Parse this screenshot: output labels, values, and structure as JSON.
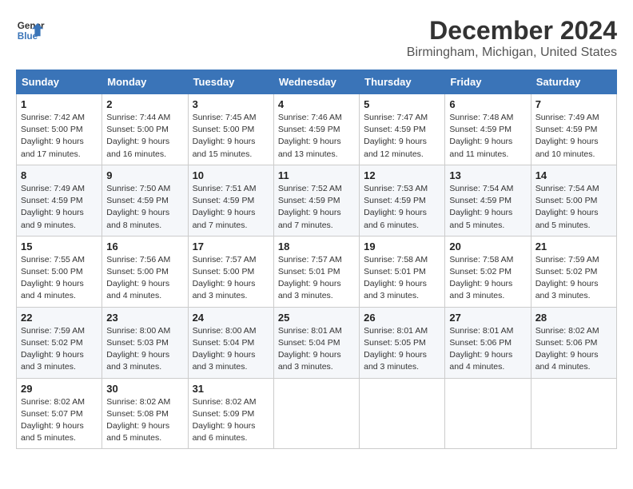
{
  "header": {
    "logo_line1": "General",
    "logo_line2": "Blue",
    "main_title": "December 2024",
    "sub_title": "Birmingham, Michigan, United States"
  },
  "columns": [
    "Sunday",
    "Monday",
    "Tuesday",
    "Wednesday",
    "Thursday",
    "Friday",
    "Saturday"
  ],
  "weeks": [
    [
      {
        "day": "1",
        "sunrise": "7:42 AM",
        "sunset": "5:00 PM",
        "daylight": "9 hours and 17 minutes."
      },
      {
        "day": "2",
        "sunrise": "7:44 AM",
        "sunset": "5:00 PM",
        "daylight": "9 hours and 16 minutes."
      },
      {
        "day": "3",
        "sunrise": "7:45 AM",
        "sunset": "5:00 PM",
        "daylight": "9 hours and 15 minutes."
      },
      {
        "day": "4",
        "sunrise": "7:46 AM",
        "sunset": "4:59 PM",
        "daylight": "9 hours and 13 minutes."
      },
      {
        "day": "5",
        "sunrise": "7:47 AM",
        "sunset": "4:59 PM",
        "daylight": "9 hours and 12 minutes."
      },
      {
        "day": "6",
        "sunrise": "7:48 AM",
        "sunset": "4:59 PM",
        "daylight": "9 hours and 11 minutes."
      },
      {
        "day": "7",
        "sunrise": "7:49 AM",
        "sunset": "4:59 PM",
        "daylight": "9 hours and 10 minutes."
      }
    ],
    [
      {
        "day": "8",
        "sunrise": "7:49 AM",
        "sunset": "4:59 PM",
        "daylight": "9 hours and 9 minutes."
      },
      {
        "day": "9",
        "sunrise": "7:50 AM",
        "sunset": "4:59 PM",
        "daylight": "9 hours and 8 minutes."
      },
      {
        "day": "10",
        "sunrise": "7:51 AM",
        "sunset": "4:59 PM",
        "daylight": "9 hours and 7 minutes."
      },
      {
        "day": "11",
        "sunrise": "7:52 AM",
        "sunset": "4:59 PM",
        "daylight": "9 hours and 7 minutes."
      },
      {
        "day": "12",
        "sunrise": "7:53 AM",
        "sunset": "4:59 PM",
        "daylight": "9 hours and 6 minutes."
      },
      {
        "day": "13",
        "sunrise": "7:54 AM",
        "sunset": "4:59 PM",
        "daylight": "9 hours and 5 minutes."
      },
      {
        "day": "14",
        "sunrise": "7:54 AM",
        "sunset": "5:00 PM",
        "daylight": "9 hours and 5 minutes."
      }
    ],
    [
      {
        "day": "15",
        "sunrise": "7:55 AM",
        "sunset": "5:00 PM",
        "daylight": "9 hours and 4 minutes."
      },
      {
        "day": "16",
        "sunrise": "7:56 AM",
        "sunset": "5:00 PM",
        "daylight": "9 hours and 4 minutes."
      },
      {
        "day": "17",
        "sunrise": "7:57 AM",
        "sunset": "5:00 PM",
        "daylight": "9 hours and 3 minutes."
      },
      {
        "day": "18",
        "sunrise": "7:57 AM",
        "sunset": "5:01 PM",
        "daylight": "9 hours and 3 minutes."
      },
      {
        "day": "19",
        "sunrise": "7:58 AM",
        "sunset": "5:01 PM",
        "daylight": "9 hours and 3 minutes."
      },
      {
        "day": "20",
        "sunrise": "7:58 AM",
        "sunset": "5:02 PM",
        "daylight": "9 hours and 3 minutes."
      },
      {
        "day": "21",
        "sunrise": "7:59 AM",
        "sunset": "5:02 PM",
        "daylight": "9 hours and 3 minutes."
      }
    ],
    [
      {
        "day": "22",
        "sunrise": "7:59 AM",
        "sunset": "5:02 PM",
        "daylight": "9 hours and 3 minutes."
      },
      {
        "day": "23",
        "sunrise": "8:00 AM",
        "sunset": "5:03 PM",
        "daylight": "9 hours and 3 minutes."
      },
      {
        "day": "24",
        "sunrise": "8:00 AM",
        "sunset": "5:04 PM",
        "daylight": "9 hours and 3 minutes."
      },
      {
        "day": "25",
        "sunrise": "8:01 AM",
        "sunset": "5:04 PM",
        "daylight": "9 hours and 3 minutes."
      },
      {
        "day": "26",
        "sunrise": "8:01 AM",
        "sunset": "5:05 PM",
        "daylight": "9 hours and 3 minutes."
      },
      {
        "day": "27",
        "sunrise": "8:01 AM",
        "sunset": "5:06 PM",
        "daylight": "9 hours and 4 minutes."
      },
      {
        "day": "28",
        "sunrise": "8:02 AM",
        "sunset": "5:06 PM",
        "daylight": "9 hours and 4 minutes."
      }
    ],
    [
      {
        "day": "29",
        "sunrise": "8:02 AM",
        "sunset": "5:07 PM",
        "daylight": "9 hours and 5 minutes."
      },
      {
        "day": "30",
        "sunrise": "8:02 AM",
        "sunset": "5:08 PM",
        "daylight": "9 hours and 5 minutes."
      },
      {
        "day": "31",
        "sunrise": "8:02 AM",
        "sunset": "5:09 PM",
        "daylight": "9 hours and 6 minutes."
      },
      null,
      null,
      null,
      null
    ]
  ],
  "labels": {
    "sunrise": "Sunrise:",
    "sunset": "Sunset:",
    "daylight": "Daylight:"
  }
}
